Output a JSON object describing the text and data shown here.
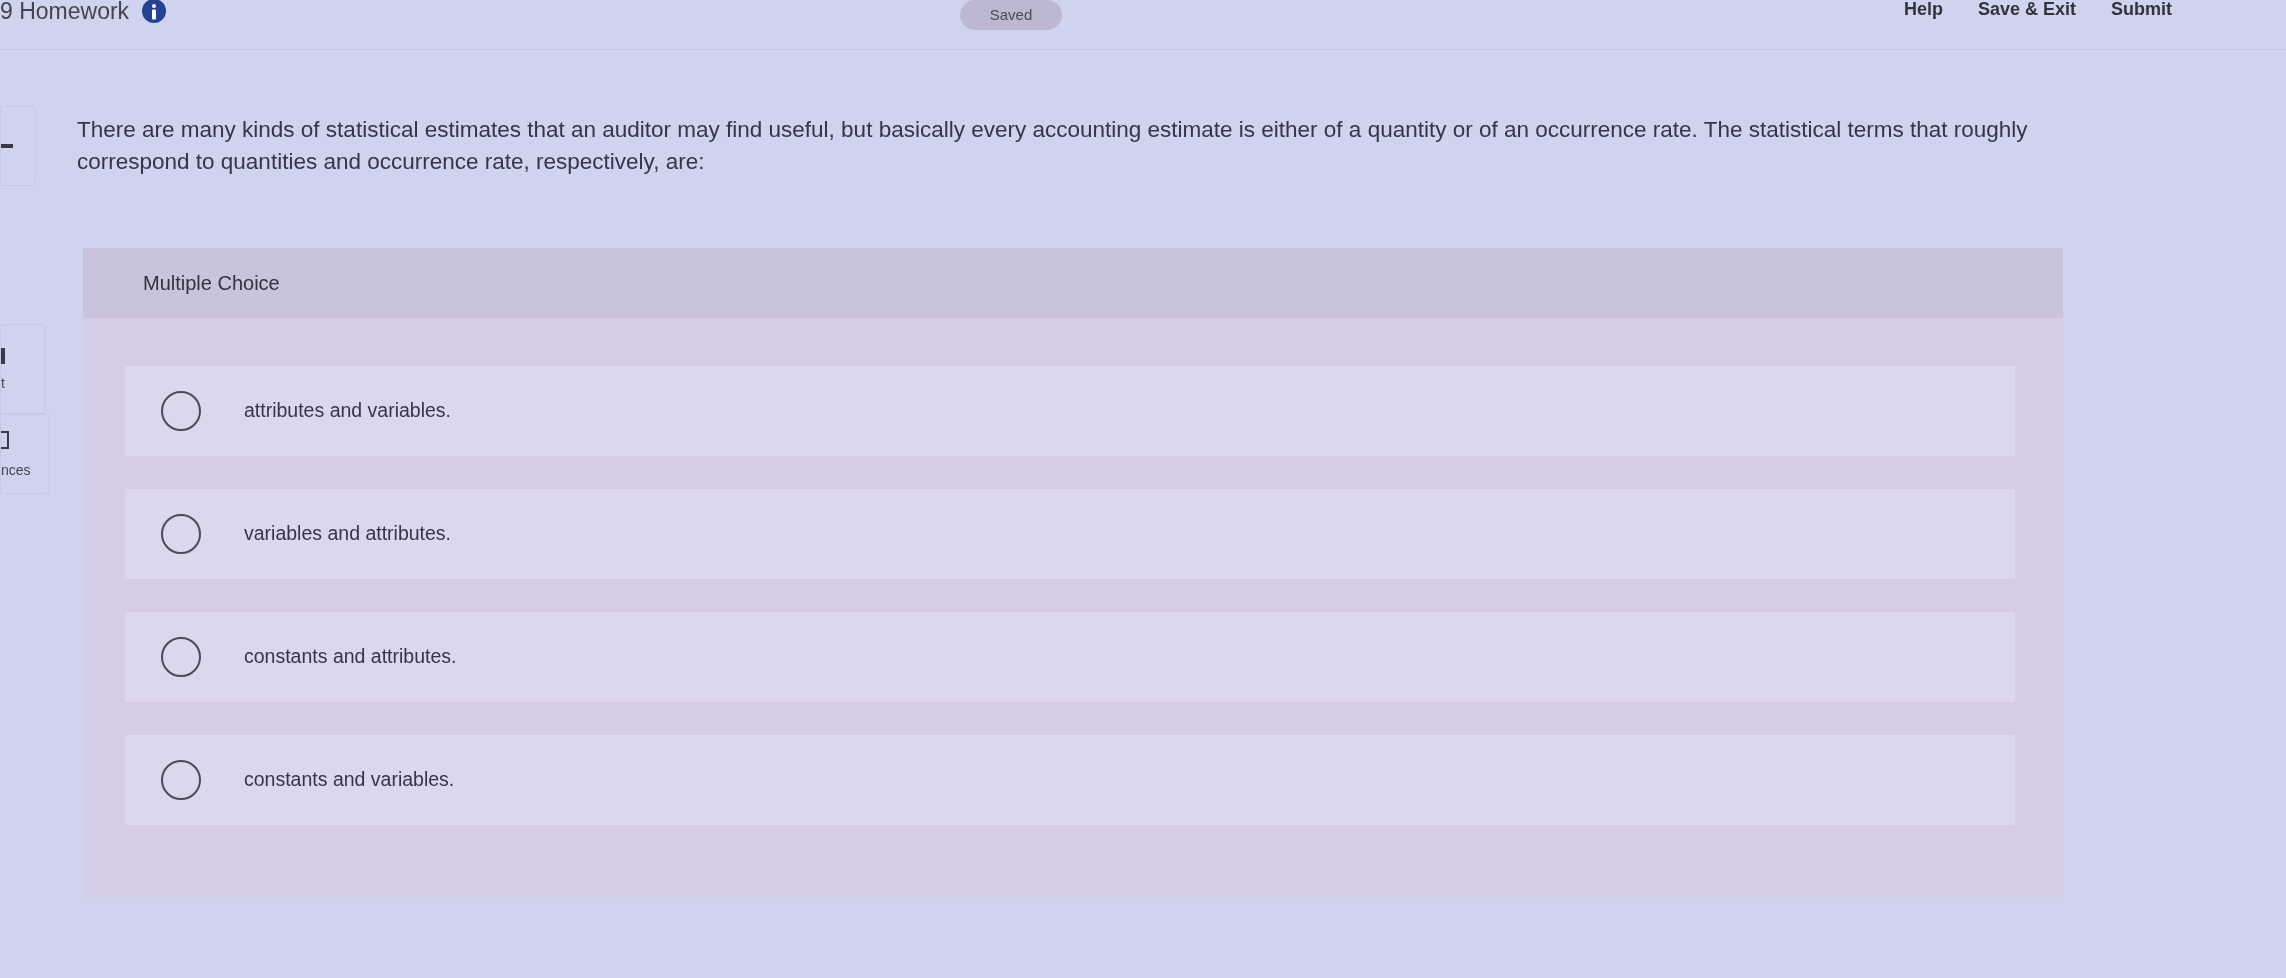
{
  "header": {
    "title": "9 Homework",
    "status": "Saved",
    "links": [
      "Help",
      "Save & Exit",
      "Submit"
    ]
  },
  "sidebar": {
    "items": [
      "t",
      "nces"
    ]
  },
  "question": {
    "text": "There are many kinds of statistical estimates that an auditor may find useful, but basically every accounting estimate is either of a quantity or of an occurrence rate. The statistical terms that roughly correspond to quantities and occurrence rate, respectively, are:"
  },
  "answer_panel": {
    "title": "Multiple Choice",
    "options": [
      {
        "label": "attributes and variables.",
        "selected": false
      },
      {
        "label": "variables and attributes.",
        "selected": false
      },
      {
        "label": "constants and attributes.",
        "selected": false
      },
      {
        "label": "constants and variables.",
        "selected": false
      }
    ]
  }
}
